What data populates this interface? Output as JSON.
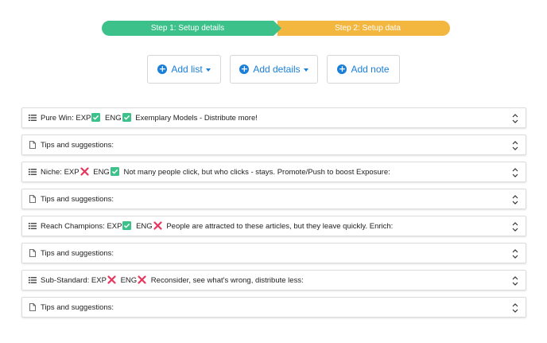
{
  "stepper": {
    "step1": "Step 1: Setup details",
    "step2": "Step 2: Setup data",
    "colors": {
      "step1": "#3cc18b",
      "step2": "#f3b63f"
    }
  },
  "actions": {
    "add_list": "Add list",
    "add_details": "Add details",
    "add_note": "Add note",
    "accent": "#1a7fd9"
  },
  "rows": [
    {
      "icon": "list-icon",
      "name": "Pure Win:",
      "exp": "check",
      "eng": "check",
      "desc": "Exemplary Models - Distribute more!"
    },
    {
      "icon": "file-icon",
      "text": "Tips and suggestions:"
    },
    {
      "icon": "list-icon",
      "name": "Niche:",
      "exp": "cross",
      "eng": "check",
      "desc": "Not many people click, but who clicks - stays. Promote/Push to boost Exposure:"
    },
    {
      "icon": "file-icon",
      "text": "Tips and suggestions:"
    },
    {
      "icon": "list-icon",
      "name": "Reach Champions:",
      "exp": "check",
      "eng": "cross",
      "desc": "People are attracted to these articles, but they leave quickly. Enrich:"
    },
    {
      "icon": "file-icon",
      "text": "Tips and suggestions:"
    },
    {
      "icon": "list-icon",
      "name": "Sub-Standard:",
      "exp": "cross",
      "eng": "cross",
      "desc": "Reconsider, see what's wrong, distribute less:"
    },
    {
      "icon": "file-icon",
      "text": "Tips and suggestions:"
    }
  ],
  "labels": {
    "exp": "EXP",
    "eng": "ENG"
  },
  "badge_colors": {
    "check": "#3cc18b",
    "cross": "#e8365d"
  }
}
